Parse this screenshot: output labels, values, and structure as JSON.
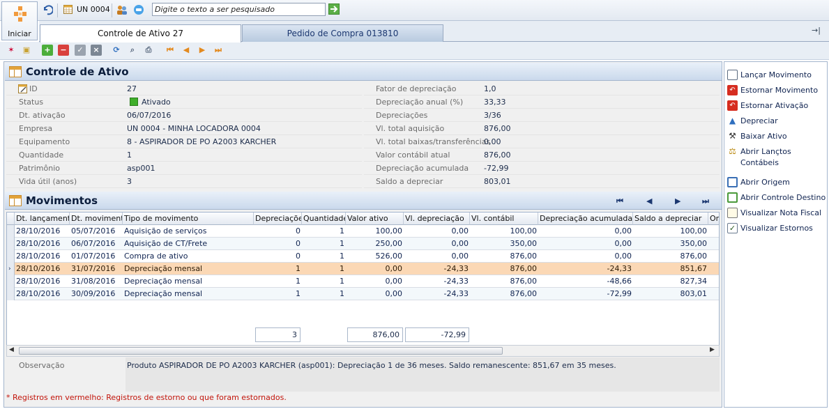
{
  "topbar": {
    "start_label": "Iniciar",
    "unit_label": "UN 0004",
    "search_placeholder": "Digite o texto a ser pesquisado"
  },
  "tabs": [
    {
      "label": "Controle de Ativo 27"
    },
    {
      "label": "Pedido de Compra 013810"
    }
  ],
  "asset": {
    "title": "Controle de Ativo",
    "left_fields": [
      {
        "label": "ID",
        "value": "27"
      },
      {
        "label": "Status",
        "value": "Ativado"
      },
      {
        "label": "Dt. ativação",
        "value": "06/07/2016"
      },
      {
        "label": "Empresa",
        "value": "UN 0004 - MINHA LOCADORA 0004"
      },
      {
        "label": "Equipamento",
        "value": "8 - ASPIRADOR DE PO A2003 KARCHER"
      },
      {
        "label": "Quantidade",
        "value": "1"
      },
      {
        "label": "Patrimônio",
        "value": "asp001"
      },
      {
        "label": "Vida útil (anos)",
        "value": "3"
      }
    ],
    "right_fields": [
      {
        "label": "Fator de depreciação",
        "value": "1,0"
      },
      {
        "label": "Depreciação anual (%)",
        "value": "33,33"
      },
      {
        "label": "Depreciações",
        "value": "3/36"
      },
      {
        "label": "Vl. total aquisição",
        "value": "876,00"
      },
      {
        "label": "Vl. total baixas/transferências",
        "value": "0,00"
      },
      {
        "label": "Valor contábil atual",
        "value": "876,00"
      },
      {
        "label": "Depreciação acumulada",
        "value": "-72,99"
      },
      {
        "label": "Saldo a depreciar",
        "value": "803,01"
      }
    ],
    "status_color": "#3fae2a"
  },
  "movements": {
    "title": "Movimentos",
    "columns": [
      "Dt. lançamento",
      "Dt. movimento",
      "Tipo de movimento",
      "Depreciações",
      "Quantidade",
      "Valor ativo",
      "Vl. depreciação",
      "Vl. contábil",
      "Depreciação acumulada",
      "Saldo a depreciar",
      "Ori"
    ],
    "rows": [
      [
        "28/10/2016",
        "05/07/2016",
        "Aquisição de serviços",
        "0",
        "1",
        "100,00",
        "0,00",
        "100,00",
        "0,00",
        "100,00"
      ],
      [
        "28/10/2016",
        "06/07/2016",
        "Aquisição de CT/Frete",
        "0",
        "1",
        "250,00",
        "0,00",
        "350,00",
        "0,00",
        "350,00"
      ],
      [
        "28/10/2016",
        "01/07/2016",
        "Compra de ativo",
        "0",
        "1",
        "526,00",
        "0,00",
        "876,00",
        "0,00",
        "876,00"
      ],
      [
        "28/10/2016",
        "31/07/2016",
        "Depreciação mensal",
        "1",
        "1",
        "0,00",
        "-24,33",
        "876,00",
        "-24,33",
        "851,67"
      ],
      [
        "28/10/2016",
        "31/08/2016",
        "Depreciação mensal",
        "1",
        "1",
        "0,00",
        "-24,33",
        "876,00",
        "-48,66",
        "827,34"
      ],
      [
        "28/10/2016",
        "30/09/2016",
        "Depreciação mensal",
        "1",
        "1",
        "0,00",
        "-24,33",
        "876,00",
        "-72,99",
        "803,01"
      ]
    ],
    "selected_row": 3,
    "totals": {
      "depreciacoes": "3",
      "valor_ativo": "876,00",
      "vl_depreciacao": "-72,99"
    },
    "selected_color": "#fbd8b5"
  },
  "observation": {
    "label": "Observação",
    "text": "Produto ASPIRADOR DE PO A2003 KARCHER (asp001): Depreciação 1 de 36 meses. Saldo remanescente: 851,67 em 35 meses."
  },
  "footer_note": "* Registros em vermelho:  Registros de estorno ou que foram estornados.",
  "actions": [
    {
      "label": "Lançar Movimento",
      "icon": "clipboard-icon"
    },
    {
      "label": "Estornar Movimento",
      "icon": "undo-red-icon"
    },
    {
      "label": "Estornar Ativação",
      "icon": "undo-red-icon"
    },
    {
      "label": "Depreciar",
      "icon": "triangle-blue-icon"
    },
    {
      "label": "Baixar Ativo",
      "icon": "hammer-icon"
    },
    {
      "label": "Abrir Lançtos Contábeis",
      "icon": "scale-icon"
    },
    {
      "label": "Abrir Origem",
      "icon": "window-icon"
    },
    {
      "label": "Abrir Controle Destino",
      "icon": "window-green-icon"
    },
    {
      "label": "Visualizar Nota Fiscal",
      "icon": "document-icon"
    },
    {
      "label": "Visualizar Estornos",
      "icon": "checkbox-icon"
    }
  ]
}
